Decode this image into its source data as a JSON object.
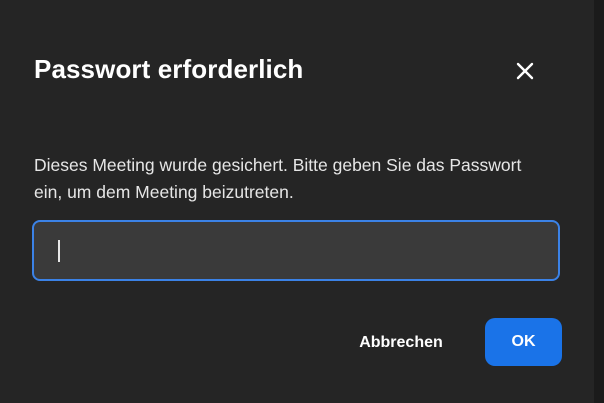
{
  "dialog": {
    "title": "Passwort erforderlich",
    "close_icon": "close-icon",
    "message": "Dieses Meeting wurde gesichert. Bitte geben Sie das Passwort ein, um dem Meeting beizutreten.",
    "password_input": {
      "value": "",
      "placeholder": ""
    },
    "cancel_label": "Abbrechen",
    "ok_label": "OK"
  },
  "colors": {
    "background": "#252525",
    "accent": "#1a73e8",
    "input_border": "#3b82e6",
    "input_background": "#3a3a3a"
  }
}
